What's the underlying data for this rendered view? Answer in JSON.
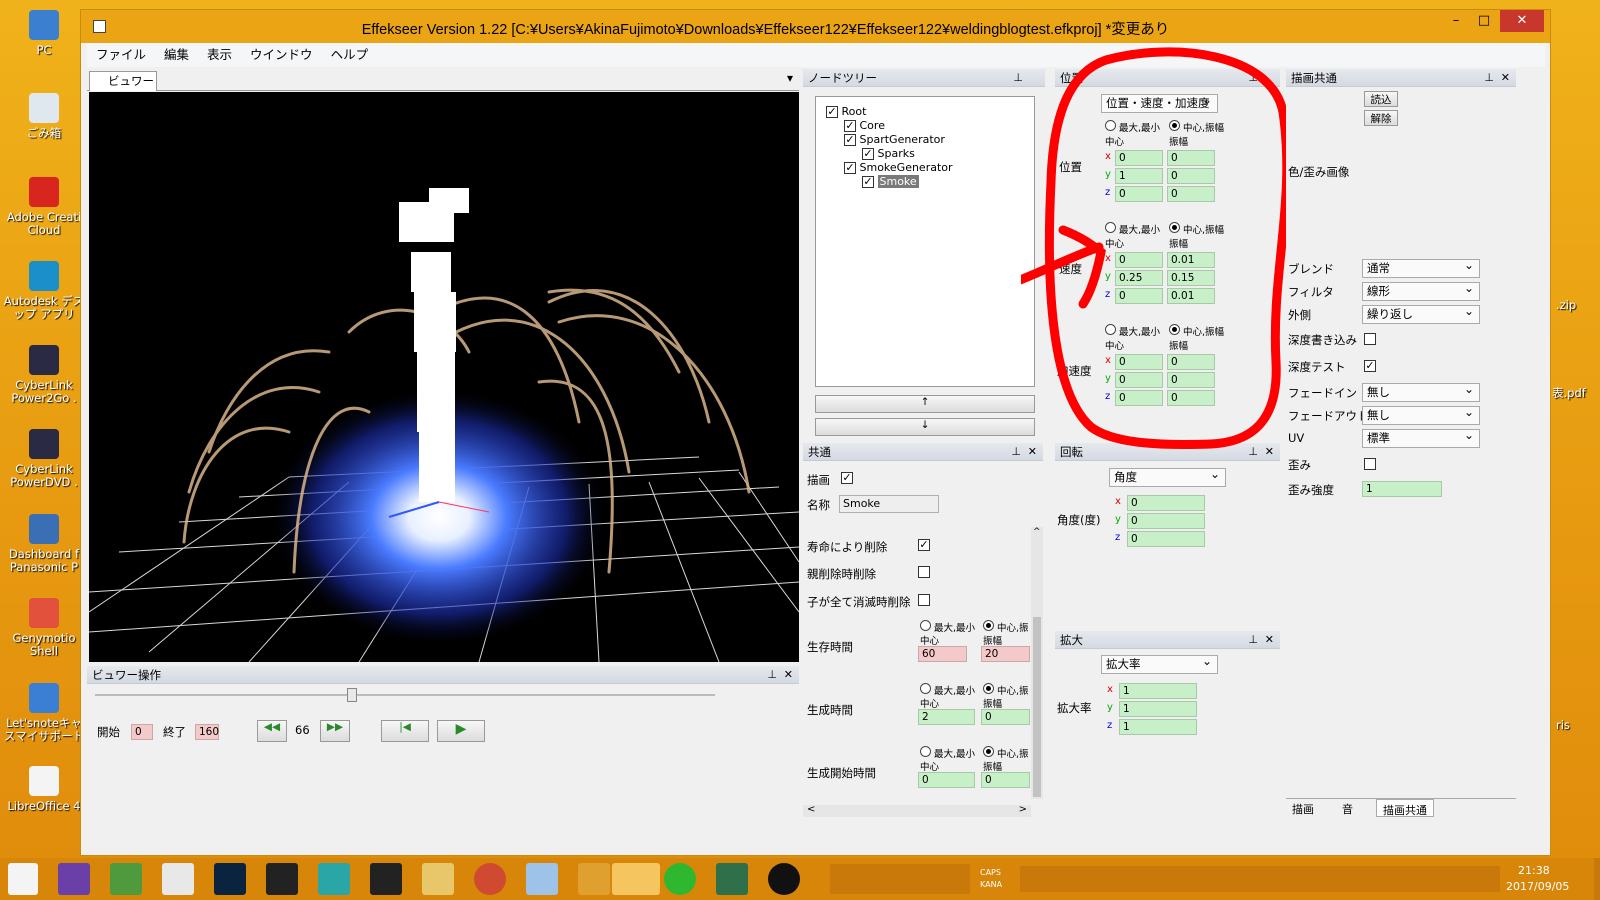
{
  "desktop": {
    "icons": [
      "PC",
      "ごみ箱",
      "Adobe Creati Cloud",
      "Autodesk デス ップ アプリ",
      "CyberLink Power2Go .",
      "CyberLink PowerDVD .",
      "Dashboard f Panasonic P",
      "Genymotio Shell",
      "Let'snoteキャ スマイサポート",
      "LibreOffice 4"
    ],
    "right_labels": [
      ".zip",
      "表.pdf",
      "ris"
    ]
  },
  "window": {
    "title": "Effekseer Version 1.22 [C:¥Users¥AkinaFujimoto¥Downloads¥Effekseer122¥Effekseer122¥weldingblogtest.efkproj]  *変更あり",
    "min": "–",
    "max": "□",
    "close": "✕"
  },
  "menu": [
    "ファイル",
    "編集",
    "表示",
    "ウインドウ",
    "ヘルプ"
  ],
  "viewer": {
    "tab": "ビュワー",
    "dropdown": "▾"
  },
  "viewer_ctrl": {
    "title": "ビュワー操作",
    "start_label": "開始",
    "start": "0",
    "end_label": "終了",
    "end": "160",
    "frame": "66",
    "rewind": "◀◀",
    "forward": "▶▶",
    "first": "|◀",
    "play": "▶"
  },
  "node_tree": {
    "title": "ノードツリー",
    "nodes": [
      {
        "label": "Root",
        "check": "✓"
      },
      {
        "label": "Core",
        "check": "✓"
      },
      {
        "label": "SpartGenerator",
        "check": "✓"
      },
      {
        "label": "Sparks",
        "check": "✓"
      },
      {
        "label": "SmokeGenerator",
        "check": "✓"
      },
      {
        "label": "Smoke",
        "check": "✓"
      }
    ],
    "up": "↑",
    "down": "↓"
  },
  "common": {
    "title": "共通",
    "draw_label": "描画",
    "draw_check": "✓",
    "name_label": "名称",
    "name": "Smoke",
    "opt1": "寿命により削除",
    "opt1_check": "✓",
    "opt2": "親削除時削除",
    "opt3": "子が全て消滅時削除",
    "life_label": "生存時間",
    "gen_label": "生成時間",
    "gen_start_label": "生成開始時間",
    "minmax": "最大,最小",
    "centeramp": "中心,振",
    "center": "中心",
    "amp": "振幅",
    "life_center": "60",
    "life_amp": "20",
    "gen_center": "2",
    "gen_amp": "0",
    "start_center": "0",
    "start_amp": "0",
    "scroll_left": "<",
    "scroll_right": ">",
    "scroll_up": "^",
    "scroll_down": "v"
  },
  "position": {
    "title": "位置",
    "mode": "位置・速度・加速度",
    "minmax": "最大,最小",
    "centeramp": "中心,振幅",
    "center": "中心",
    "amp": "振幅",
    "pos_label": "位置",
    "vel_label": "速度",
    "acc_label": "加速度",
    "pos": {
      "x": [
        "0",
        "0"
      ],
      "y": [
        "1",
        "0"
      ],
      "z": [
        "0",
        "0"
      ]
    },
    "vel": {
      "x": [
        "0",
        "0.01"
      ],
      "y": [
        "0.25",
        "0.15"
      ],
      "z": [
        "0",
        "0.01"
      ]
    },
    "acc": {
      "x": [
        "0",
        "0"
      ],
      "y": [
        "0",
        "0"
      ],
      "z": [
        "0",
        "0"
      ]
    },
    "annotation_color": "#ff0000"
  },
  "rotation": {
    "title": "回転",
    "mode": "角度",
    "label": "角度(度)",
    "x": "0",
    "y": "0",
    "z": "0"
  },
  "scale": {
    "title": "拡大",
    "mode": "拡大率",
    "label": "拡大率",
    "x": "1",
    "y": "1",
    "z": "1"
  },
  "render_common": {
    "title": "描画共通",
    "load": "読込",
    "release": "解除",
    "color_image": "色/歪み画像",
    "blend_label": "ブレンド",
    "blend": "通常",
    "filter_label": "フィルタ",
    "filter": "線形",
    "wrap_label": "外側",
    "wrap": "繰り返し",
    "zwrite_label": "深度書き込み",
    "ztest_label": "深度テスト",
    "ztest_check": "✓",
    "fadein_label": "フェードイン",
    "fadein": "無し",
    "fadeout_label": "フェードアウト",
    "fadeout": "無し",
    "uv_label": "UV",
    "uv": "標準",
    "distortion_label": "歪み",
    "distortion_strength_label": "歪み強度",
    "distortion_strength": "1",
    "tabs": [
      "描画",
      "音",
      "描画共通"
    ]
  },
  "axes": {
    "x": "x",
    "y": "y",
    "z": "z"
  },
  "pin": "⊥",
  "close": "✕",
  "taskbar": {
    "time": "21:38",
    "date": "2017/09/05",
    "caps": "CAPS",
    "kana": "KANA",
    "apps": [
      "windows-start",
      "visual-studio",
      "app-green",
      "app-chrome-like",
      "photoshop",
      "checker",
      "maya",
      "film",
      "explorer",
      "chrome",
      "app-paper",
      "app-r",
      "app-circle",
      "line",
      "app-window",
      "recorder"
    ]
  }
}
